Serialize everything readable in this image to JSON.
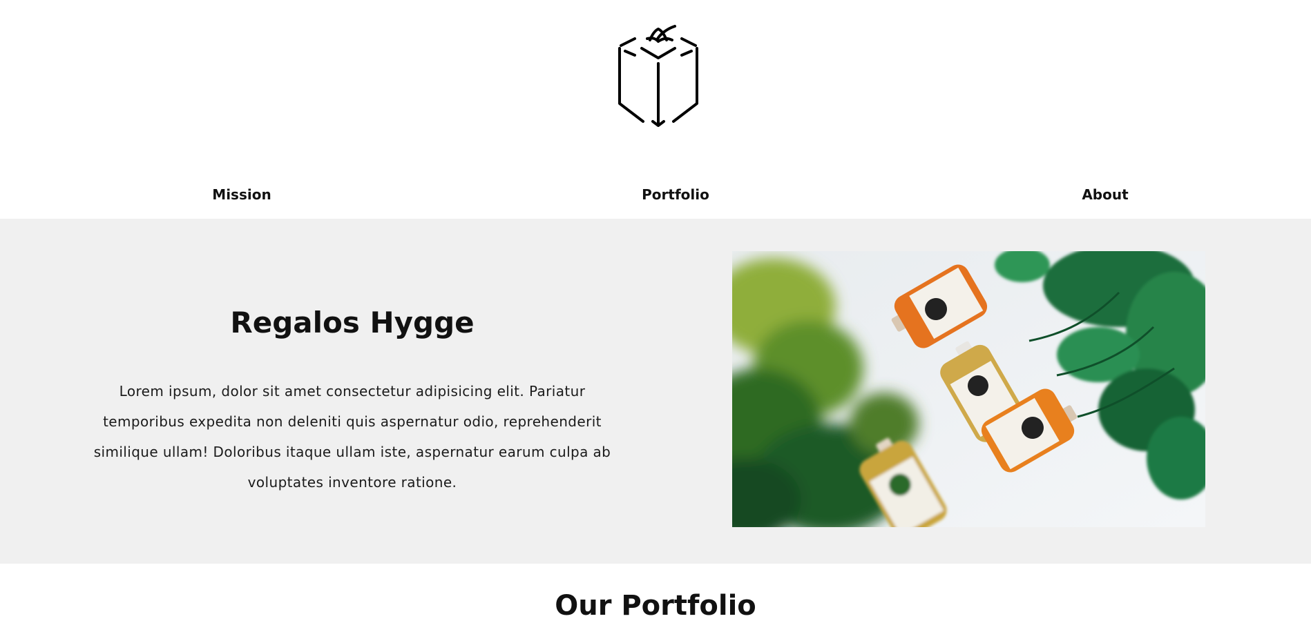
{
  "header": {
    "logo_icon": "gift-box-logo-icon"
  },
  "nav": {
    "items": [
      {
        "label": "Mission"
      },
      {
        "label": "Portfolio"
      },
      {
        "label": "About"
      }
    ]
  },
  "hero": {
    "title": "Regalos Hygge",
    "text": "Lorem ipsum, dolor sit amet consectetur adipisicing elit. Pariatur temporibus expedita non deleniti quis aspernatur odio, reprehenderit similique ullam! Doloribus itaque ullam iste, aspernatur earum culpa ab voluptates inventore ratione.",
    "background_color": "#f0f0f0",
    "image_icon": "juice-bottles-photo"
  },
  "portfolio": {
    "title": "Our Portfolio"
  }
}
